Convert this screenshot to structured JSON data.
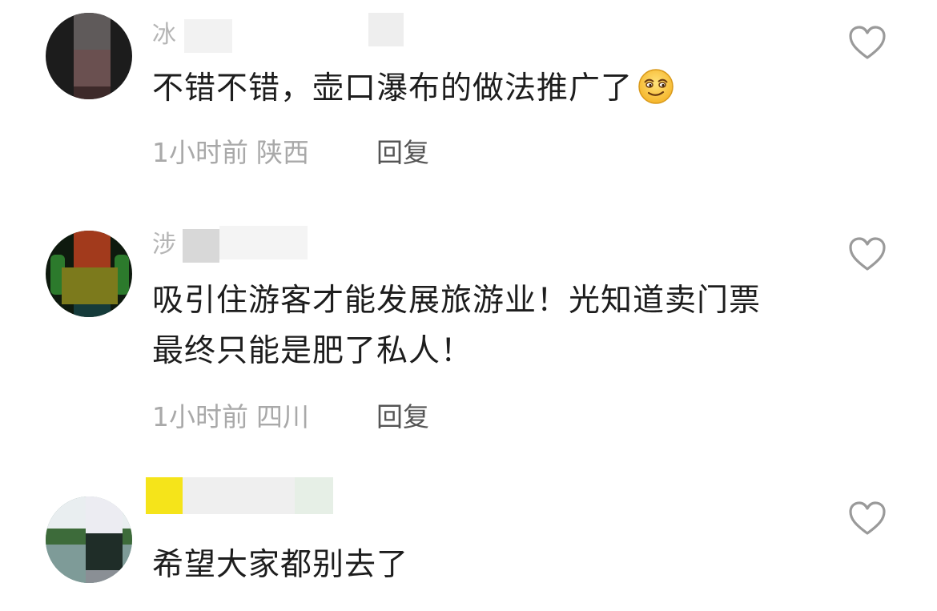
{
  "comments": [
    {
      "username": "冰",
      "text": "不错不错，壶口瀑布的做法推广了",
      "emoji": "smiling-face-emoji",
      "time": "1小时前",
      "location": "陕西",
      "reply_label": "回复"
    },
    {
      "username": "涉",
      "text": "吸引住游客才能发展旅游业！光知道卖门票最终只能是肥了私人！",
      "time": "1小时前",
      "location": "四川",
      "reply_label": "回复"
    },
    {
      "username": "",
      "text": "希望大家都别去了"
    }
  ],
  "icons": {
    "like": "heart-outline-icon"
  },
  "colors": {
    "text": "#1d1d1d",
    "meta": "#a9a9a9",
    "icon": "#9a9a9a"
  }
}
